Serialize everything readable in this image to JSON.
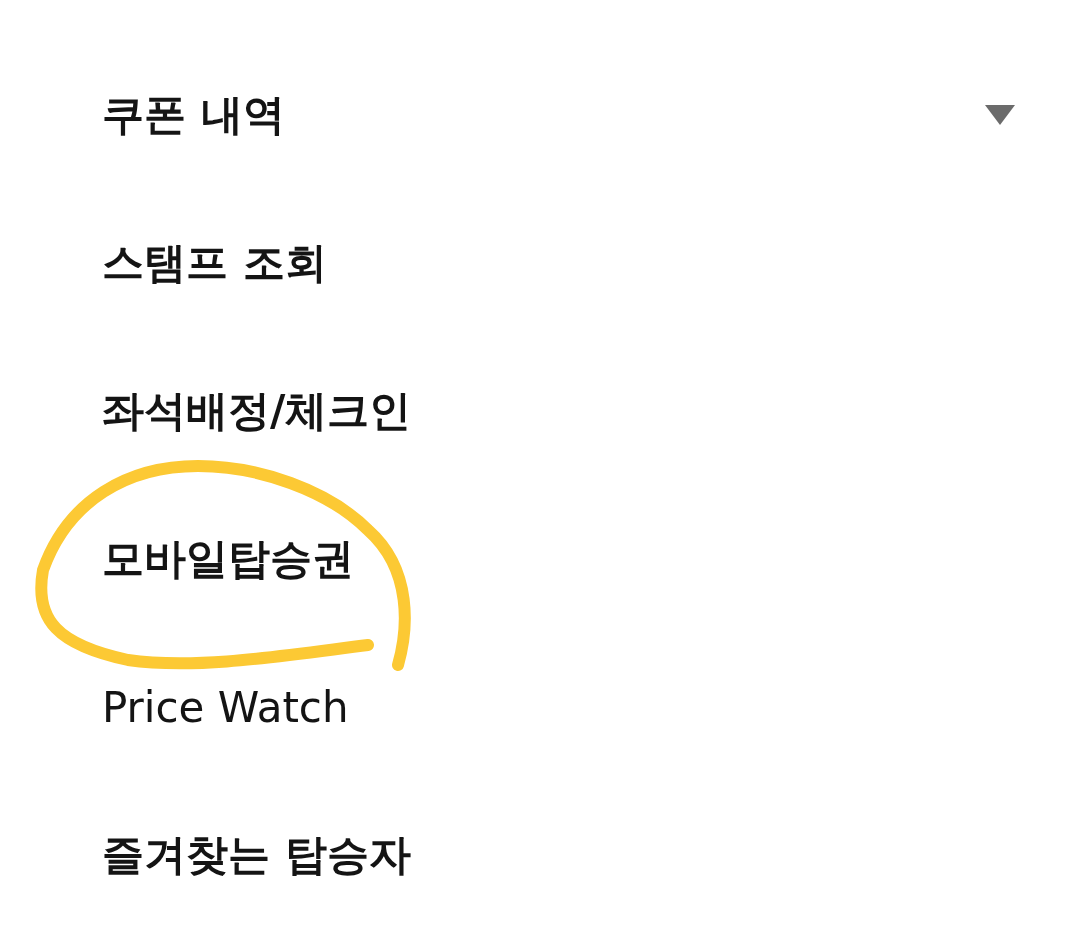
{
  "menu": {
    "items": [
      {
        "label": "쿠폰 내역",
        "bold": true,
        "expandable": true,
        "circled": false
      },
      {
        "label": "스탬프 조회",
        "bold": true,
        "expandable": false,
        "circled": false
      },
      {
        "label": "좌석배정/체크인",
        "bold": true,
        "expandable": false,
        "circled": false
      },
      {
        "label": "모바일탑승권",
        "bold": true,
        "expandable": false,
        "circled": true
      },
      {
        "label": "Price Watch",
        "bold": false,
        "expandable": false,
        "circled": false
      },
      {
        "label": "즐겨찾는 탑승자",
        "bold": true,
        "expandable": false,
        "circled": false
      }
    ]
  }
}
